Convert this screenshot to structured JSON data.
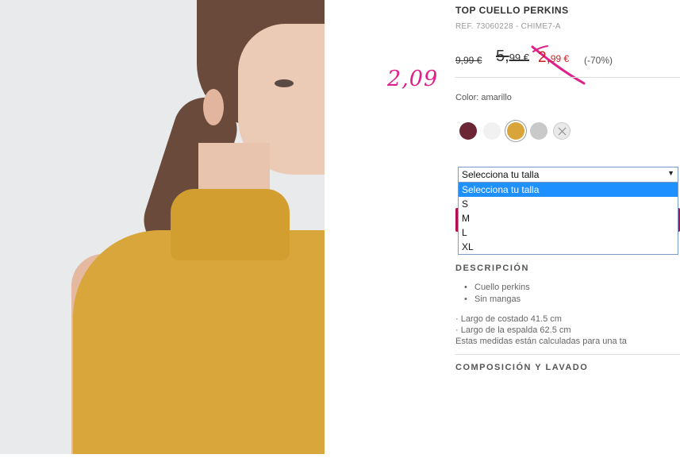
{
  "product": {
    "title": "TOP CUELLO PERKINS",
    "ref": "REF. 73060228 - CHIME7-A",
    "price_original": "9,99 €",
    "price_previous_main": "5,",
    "price_previous_cents": "99 €",
    "price_current_main": "2,",
    "price_current_cents": "99 €",
    "discount": "(-70%)",
    "color_label": "Color: amarillo"
  },
  "annotation": {
    "handwritten_price": "2,09",
    "ink_color": "#e0208a"
  },
  "swatches": [
    {
      "name": "burdeos",
      "color": "#6b2534",
      "selected": false,
      "available": true
    },
    {
      "name": "blanco",
      "color": "#f1f1f1",
      "selected": false,
      "available": true
    },
    {
      "name": "amarillo",
      "color": "#d9a43a",
      "selected": true,
      "available": true
    },
    {
      "name": "gris",
      "color": "#c9c9c9",
      "selected": false,
      "available": true
    },
    {
      "name": "no-disponible",
      "color": "#e9e9e9",
      "selected": false,
      "available": false
    }
  ],
  "size_select": {
    "value": "Selecciona tu talla",
    "options": [
      "Selecciona tu talla",
      "S",
      "M",
      "L",
      "XL"
    ],
    "highlighted_index": 0
  },
  "description": {
    "heading": "DESCRIPCIÓN",
    "bullets": [
      "Cuello perkins",
      "Sin mangas"
    ],
    "measures": [
      "· Largo de costado 41.5 cm",
      "· Largo de la espalda 62.5 cm"
    ],
    "note": "Estas medidas están calculadas para una ta"
  },
  "composition": {
    "heading": "COMPOSICIÓN Y LAVADO"
  },
  "colors": {
    "sale_red": "#cc1f1f",
    "cta_brand": "#b0104f",
    "dropdown_highlight": "#1e90ff"
  }
}
